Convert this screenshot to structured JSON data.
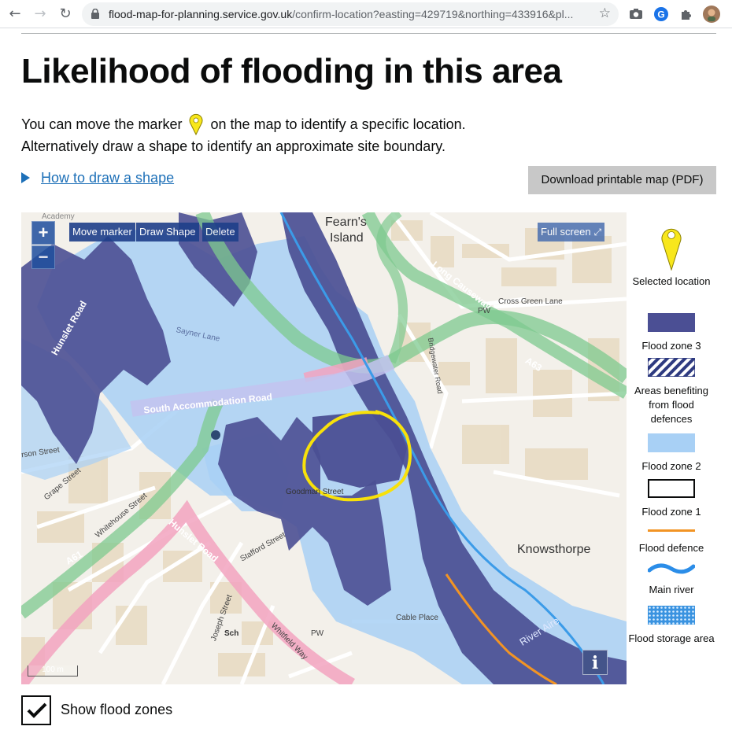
{
  "browser": {
    "url_host": "flood-map-for-planning.service.gov.uk",
    "url_path": "/confirm-location?easting=429719&northing=433916&pl..."
  },
  "page": {
    "title": "Likelihood of flooding in this area",
    "intro_part1": "You can move the marker",
    "intro_part2": "on the map to identify a specific location.",
    "intro_line2": "Alternatively draw a shape to identify an approximate site boundary.",
    "how_to_link": "How to draw a shape",
    "download_button": "Download printable map (PDF)"
  },
  "map": {
    "controls": {
      "zoom_in": "+",
      "zoom_out": "−",
      "move_marker": "Move marker",
      "draw_shape": "Draw Shape",
      "delete": "Delete",
      "full_screen": "Full screen",
      "info": "i",
      "scale": "100 m"
    },
    "labels": {
      "fearns_island_1": "Fearn's",
      "fearns_island_2": "Island",
      "knowsthorpe": "Knowsthorpe",
      "long_causeway": "Long Causeway",
      "river_aire": "River Aire",
      "south_accommodation_road": "South Accommodation Road",
      "hunslet_road_1": "Hunslet Road",
      "hunslet_road_2": "Hunslet Road",
      "a61": "A61",
      "a63": "A63",
      "cross_green_lane": "Cross Green Lane",
      "goodman_street": "Goodman Street",
      "cable_place": "Cable Place",
      "whitehouse_street": "Whitehouse Street",
      "grape_street": "Grape Street",
      "stafford_street": "Stafford Street",
      "whitfield_way": "Whitfield Way",
      "joseph_street": "Joseph Street",
      "sayner_lane": "Sayner Lane",
      "academy": "Academy",
      "pw1": "PW",
      "pw2": "PW",
      "sch": "Sch",
      "bridgewater_road": "Bridgewater Road",
      "larson_street": "rson Street"
    }
  },
  "legend": {
    "selected_location": "Selected location",
    "flood_zone_3": "Flood zone 3",
    "areas_benefiting": "Areas benefiting from flood defences",
    "flood_zone_2": "Flood zone 2",
    "flood_zone_1": "Flood zone 1",
    "flood_defence": "Flood defence",
    "main_river": "Main river",
    "flood_storage": "Flood storage area"
  },
  "checkbox": {
    "label": "Show flood zones",
    "checked": true
  },
  "colors": {
    "zone3": "#4b4f94",
    "zone2": "#a8d0f5",
    "link": "#1d70b8",
    "marker": "#f8e71c",
    "river": "#3b9be8",
    "defence": "#f29424"
  }
}
